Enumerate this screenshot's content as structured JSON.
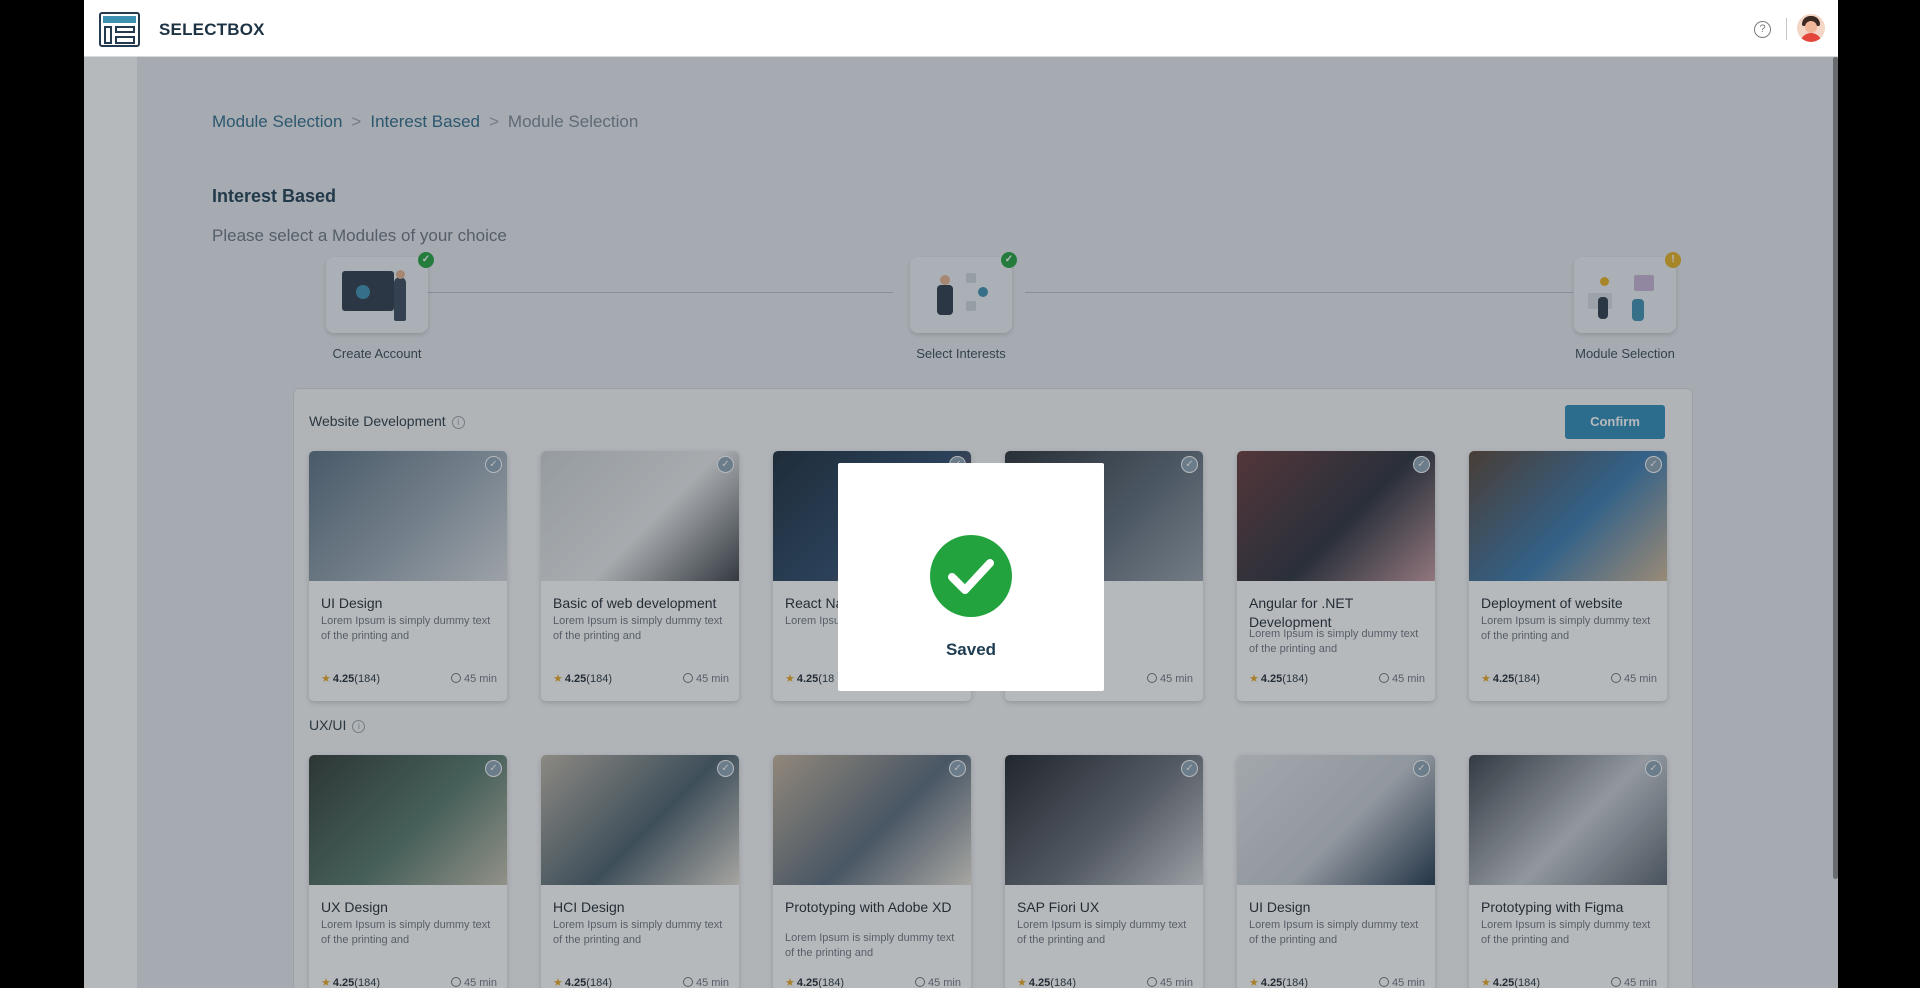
{
  "app": {
    "brand": "SELECTBOX"
  },
  "breadcrumb": [
    {
      "label": "Module Selection"
    },
    {
      "label": "Interest Based"
    },
    {
      "label": "Module Selection"
    }
  ],
  "breadcrumb_separator": ">",
  "page": {
    "title": "Interest Based",
    "subtitle": "Please select a Modules of your choice"
  },
  "steps": [
    {
      "label": "Create Account",
      "status": "done",
      "badge": "✓",
      "badge_color": "#22a33e"
    },
    {
      "label": "Select Interests",
      "status": "done",
      "badge": "✓",
      "badge_color": "#22a33e"
    },
    {
      "label": "Module Selection",
      "status": "pending",
      "badge": "!",
      "badge_color": "#e8b020"
    }
  ],
  "confirm_label": "Confirm",
  "sections": [
    {
      "title": "Website Development",
      "info_icon": "i",
      "cards": [
        {
          "title": "UI Design",
          "desc": "Lorem Ipsum is simply dummy text of the printing and",
          "rating": "4.25",
          "reviews": "(184)",
          "duration": "45 min"
        },
        {
          "title": "Basic of web development",
          "desc": "Lorem Ipsum is simply dummy text of the printing and",
          "rating": "4.25",
          "reviews": "(184)",
          "duration": "45 min"
        },
        {
          "title": "React Na",
          "desc": "Lorem Ipsu text of the",
          "rating": "4.25",
          "reviews": "(18",
          "duration": ""
        },
        {
          "title": "view",
          "desc": "ng and",
          "rating": "",
          "reviews": "",
          "duration": "45 min"
        },
        {
          "title": "Angular for .NET Development",
          "desc": "Lorem Ipsum is simply dummy text of the printing and",
          "rating": "4.25",
          "reviews": "(184)",
          "duration": "45 min"
        },
        {
          "title": "Deployment of website",
          "desc": "Lorem Ipsum is simply dummy text of the printing and",
          "rating": "4.25",
          "reviews": "(184)",
          "duration": "45 min"
        }
      ]
    },
    {
      "title": "UX/UI",
      "info_icon": "i",
      "cards": [
        {
          "title": "UX Design",
          "desc": "Lorem Ipsum is simply dummy text of the printing and",
          "rating": "4.25",
          "reviews": "(184)",
          "duration": "45 min"
        },
        {
          "title": "HCI Design",
          "desc": "Lorem Ipsum is simply dummy text of the printing and",
          "rating": "4.25",
          "reviews": "(184)",
          "duration": "45 min"
        },
        {
          "title": "Prototyping with Adobe XD",
          "desc": "Lorem Ipsum is simply dummy text of the printing and",
          "rating": "4.25",
          "reviews": "(184)",
          "duration": "45 min"
        },
        {
          "title": "SAP Fiori UX",
          "desc": "Lorem Ipsum is simply dummy text of the printing and",
          "rating": "4.25",
          "reviews": "(184)",
          "duration": "45 min"
        },
        {
          "title": "UI Design",
          "desc": "Lorem Ipsum is simply dummy text of the printing and",
          "rating": "4.25",
          "reviews": "(184)",
          "duration": "45 min"
        },
        {
          "title": "Prototyping with Figma",
          "desc": "Lorem Ipsum is simply dummy text of the printing and",
          "rating": "4.25",
          "reviews": "(184)",
          "duration": "45 min"
        }
      ]
    }
  ],
  "modal": {
    "message": "Saved",
    "icon": "check-circle-icon",
    "color": "#22a33e"
  },
  "colors": {
    "accent": "#2e8ab6",
    "brand_dark": "#1d3344",
    "success": "#22a33e",
    "warning": "#e8b020"
  }
}
